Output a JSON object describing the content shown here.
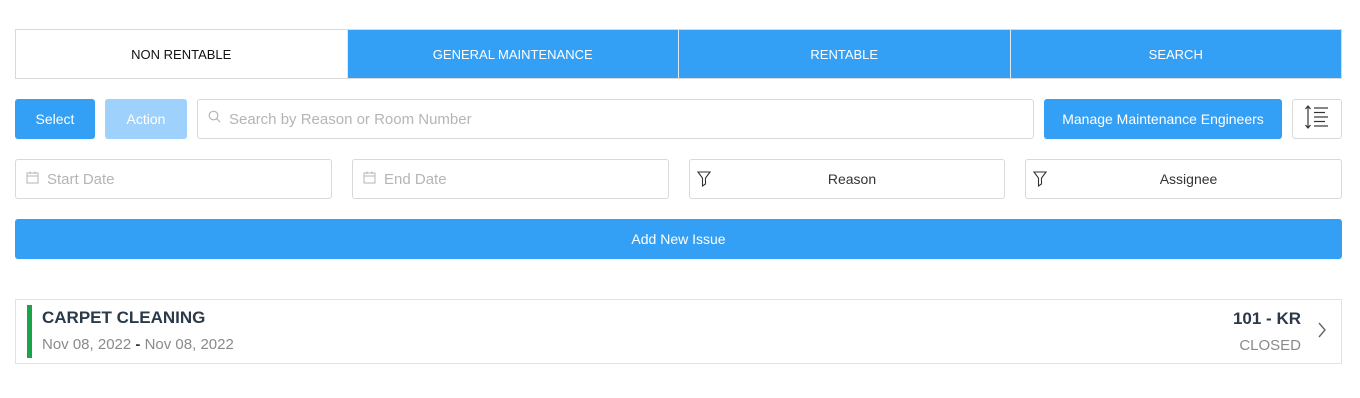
{
  "tabs": [
    {
      "label": "NON RENTABLE",
      "active": true
    },
    {
      "label": "GENERAL MAINTENANCE",
      "active": false
    },
    {
      "label": "RENTABLE",
      "active": false
    },
    {
      "label": "SEARCH",
      "active": false
    }
  ],
  "toolbar": {
    "select_label": "Select",
    "action_label": "Action",
    "search_placeholder": "Search by Reason or Room Number",
    "search_icon": "search-icon",
    "manage_label": "Manage Maintenance Engineers",
    "sort_icon": "line-height-sort-icon"
  },
  "filters": {
    "start_date_placeholder": "Start Date",
    "end_date_placeholder": "End Date",
    "reason_label": "Reason",
    "assignee_label": "Assignee",
    "calendar_icon": "calendar-icon",
    "filter_icon": "funnel-icon"
  },
  "add_issue_label": "Add New Issue",
  "issues": [
    {
      "title": "CARPET CLEANING",
      "start_date": "Nov 08, 2022",
      "separator": "-",
      "end_date": "Nov 08, 2022",
      "room": "101 - KR",
      "status": "CLOSED",
      "status_color": "#1aa34a"
    }
  ],
  "colors": {
    "accent": "#339ff5",
    "accent_disabled": "#9ed1fb",
    "status_closed": "#1aa34a"
  }
}
